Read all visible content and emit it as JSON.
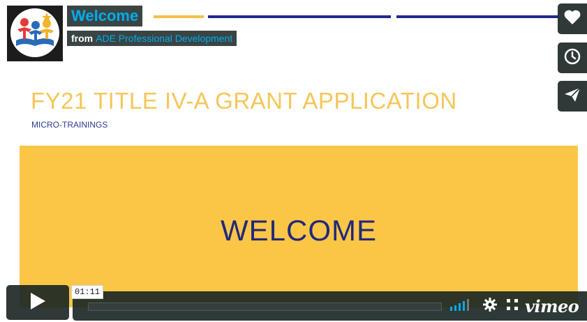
{
  "video": {
    "title": "Welcome",
    "byline_from": "from",
    "channel": "ADE Professional Development",
    "current_time": "01:11",
    "progress_fraction": 0.0
  },
  "slide": {
    "title": "FY21 TITLE IV-A GRANT APPLICATION",
    "subtitle": "MICRO-TRAININGS",
    "welcome": "WELCOME"
  },
  "side_buttons": [
    {
      "icon": "heart-icon",
      "action": "Like"
    },
    {
      "icon": "clock-icon",
      "action": "Watch Later"
    },
    {
      "icon": "paper-plane-icon",
      "action": "Share"
    }
  ],
  "controls": {
    "play_icon": "play-icon",
    "volume_icon": "volume-icon",
    "settings_icon": "gear-icon",
    "fullscreen_icon": "fullscreen-icon",
    "brand": "vimeo"
  },
  "colors": {
    "accent": "#00adef",
    "slide_yellow": "#fbc646",
    "slide_navy": "#22297a",
    "overlay": "#172322"
  }
}
